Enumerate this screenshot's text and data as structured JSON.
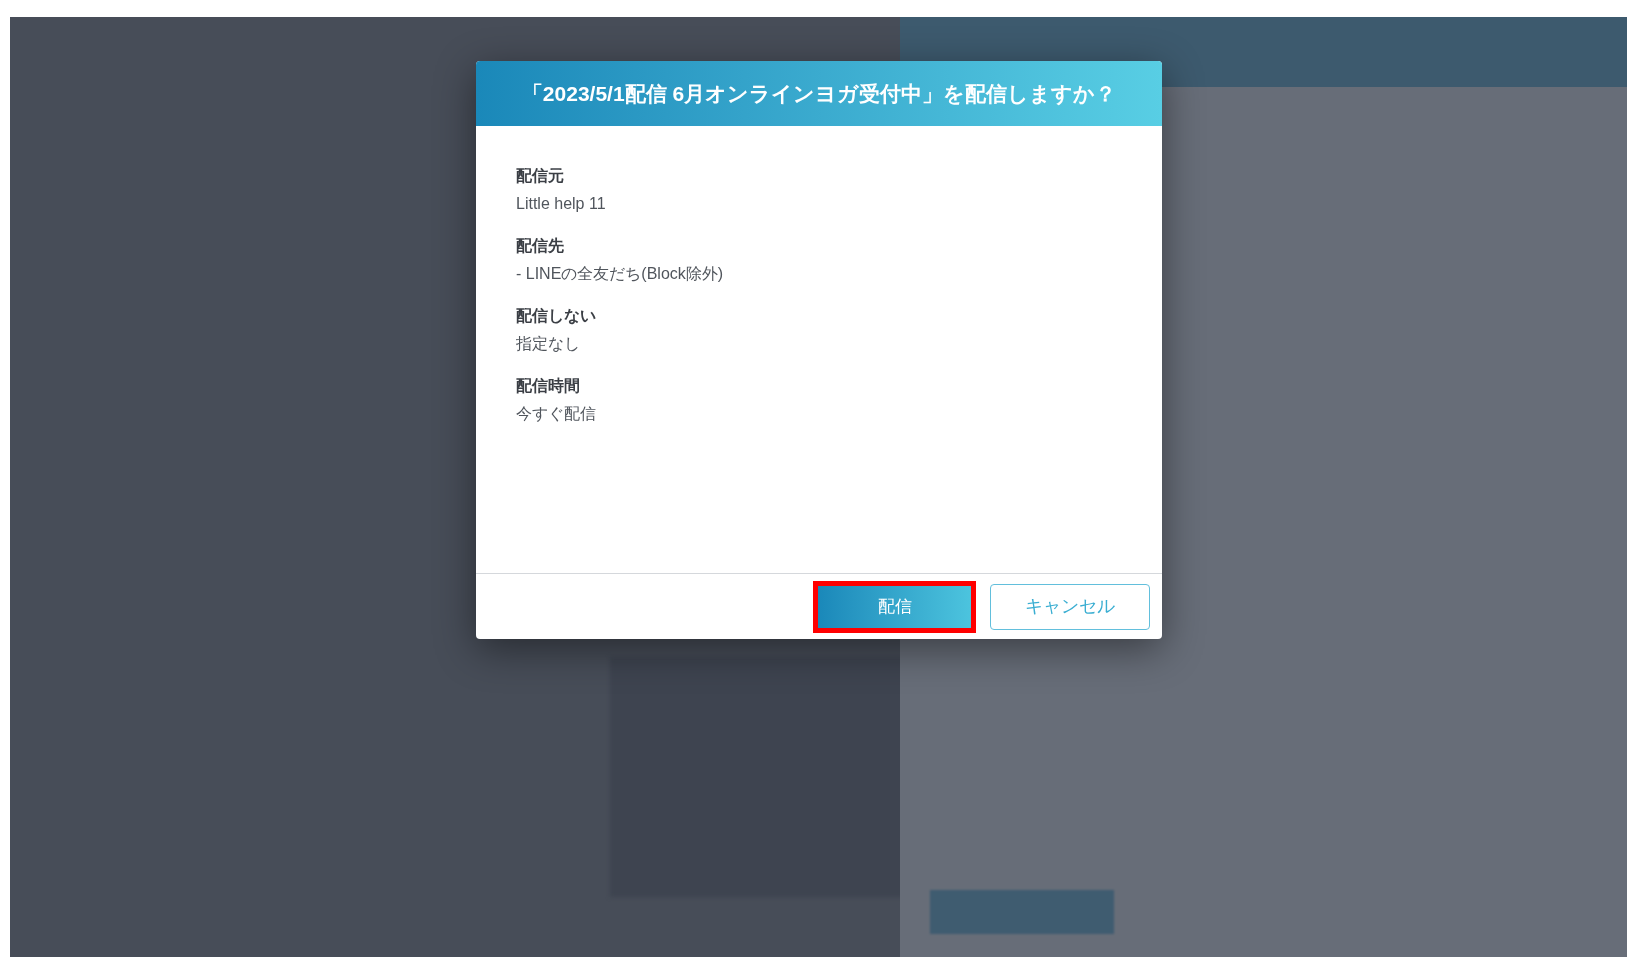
{
  "dialog": {
    "title": "「2023/5/1配信 6月オンラインヨガ受付中」を配信しますか？",
    "fields": [
      {
        "label": "配信元",
        "value": "Little help 11"
      },
      {
        "label": "配信先",
        "value": "- LINEの全友だち(Block除外)"
      },
      {
        "label": "配信しない",
        "value": "指定なし"
      },
      {
        "label": "配信時間",
        "value": "今すぐ配信"
      }
    ],
    "buttons": [
      {
        "label": "配信",
        "kind": "primary",
        "highlighted": true
      },
      {
        "label": "キャンセル",
        "kind": "secondary",
        "highlighted": false
      }
    ]
  }
}
